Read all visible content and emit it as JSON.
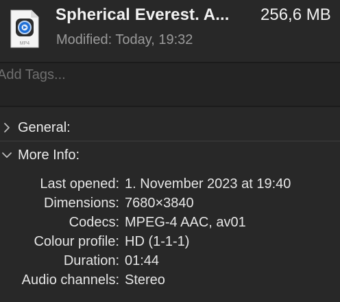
{
  "header": {
    "file_icon": "mp4-file-icon",
    "file_icon_label": "MP4",
    "title": "Spherical Everest. A...",
    "size": "256,6 MB",
    "modified": "Modified: Today, 19:32"
  },
  "tags": {
    "placeholder": "Add Tags..."
  },
  "sections": {
    "general": {
      "label": "General:",
      "icon": "chevron-right-icon",
      "expanded": false
    },
    "more_info": {
      "label": "More Info:",
      "icon": "chevron-down-icon",
      "expanded": true
    }
  },
  "more_info": {
    "rows": [
      {
        "key": "Last opened:",
        "value": "1. November 2023 at 19:40"
      },
      {
        "key": "Dimensions:",
        "value": "7680×3840"
      },
      {
        "key": "Codecs:",
        "value": "MPEG-4 AAC, av01"
      },
      {
        "key": "Colour profile:",
        "value": "HD (1-1-1)"
      },
      {
        "key": "Duration:",
        "value": "01:44"
      },
      {
        "key": "Audio channels:",
        "value": "Stereo"
      }
    ]
  },
  "colors": {
    "background": "#282828",
    "text": "#e6e6e6",
    "secondary_text": "#9b9b9b",
    "placeholder": "#6f6f6f"
  }
}
